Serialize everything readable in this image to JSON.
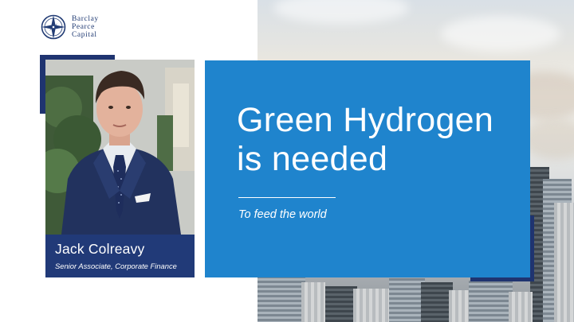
{
  "logo": {
    "lines": [
      "Barclay",
      "Pearce",
      "Capital"
    ],
    "icon": "compass-rose-icon"
  },
  "person": {
    "name": "Jack Colreavy",
    "title": "Senior Associate, Corporate Finance"
  },
  "headline": {
    "line1": "Green Hydrogen",
    "line2": "is needed",
    "subtitle": "To feed the world"
  },
  "colors": {
    "navy": "#213a78",
    "card_blue": "#1f84cd",
    "white": "#ffffff"
  }
}
